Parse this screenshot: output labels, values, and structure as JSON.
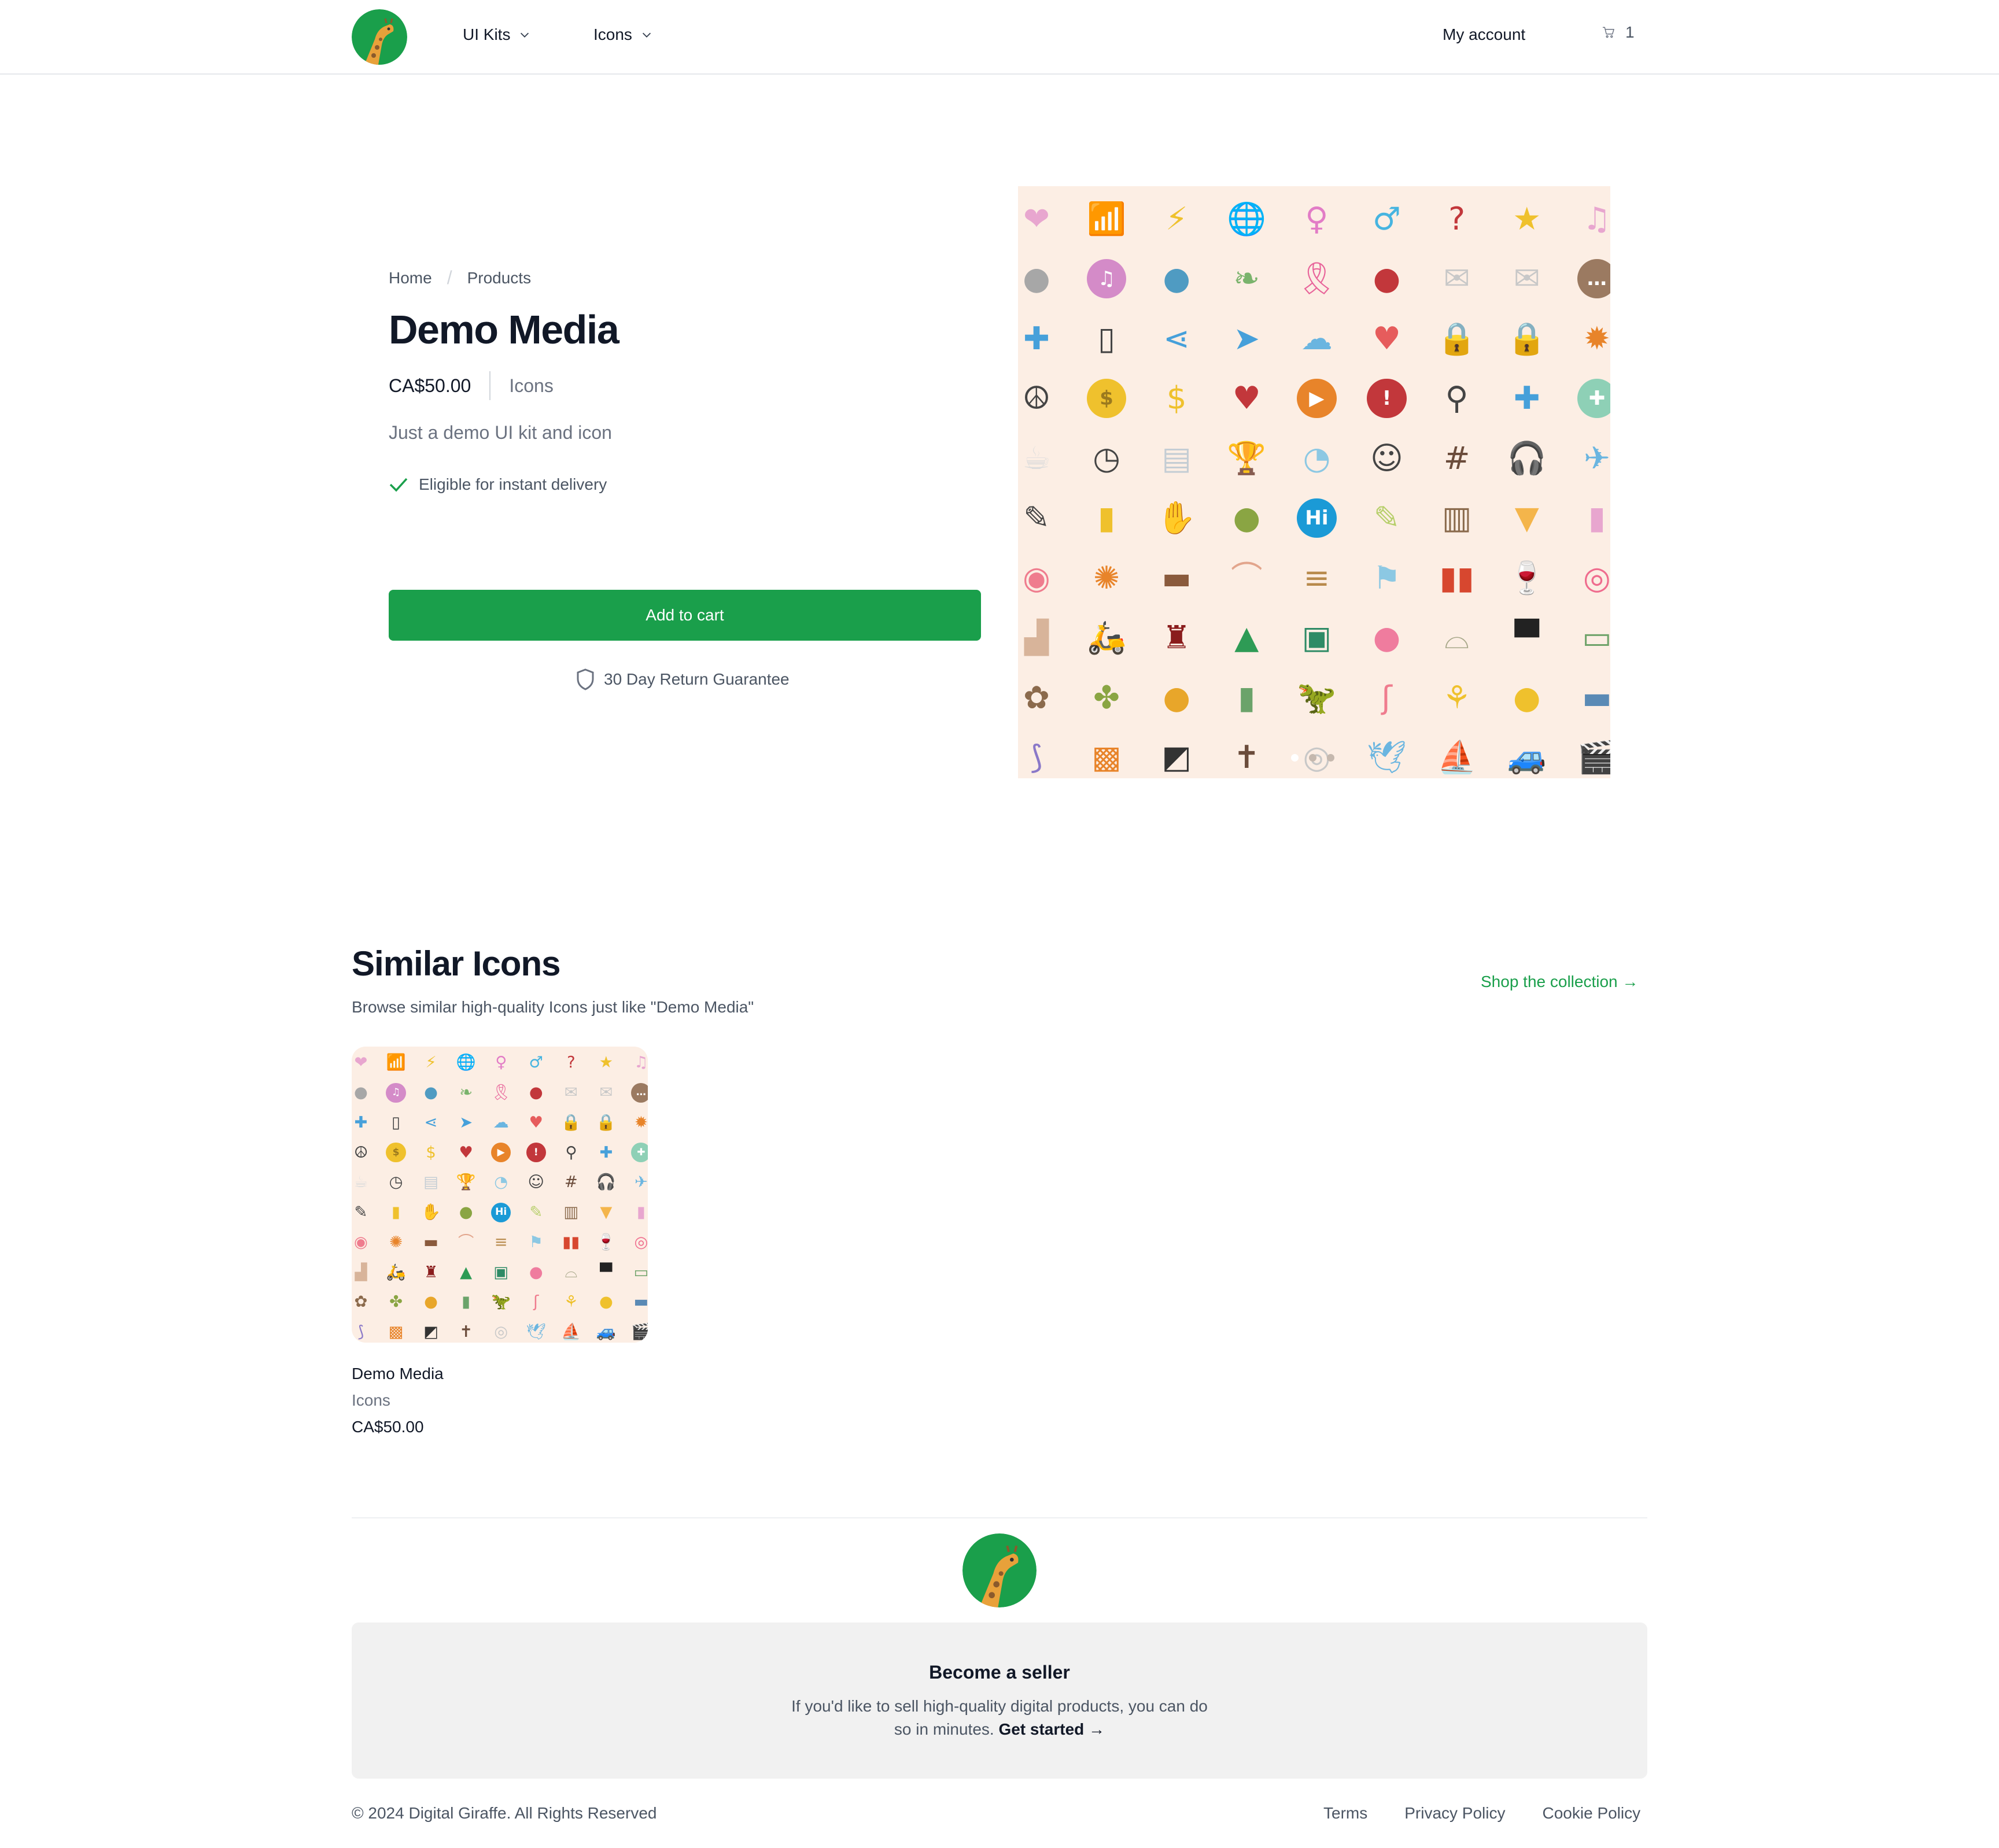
{
  "header": {
    "logo_alt": "Digital Giraffe",
    "nav": [
      {
        "label": "UI Kits"
      },
      {
        "label": "Icons"
      }
    ],
    "account_label": "My account",
    "cart_count": "1"
  },
  "product": {
    "breadcrumb": [
      {
        "label": "Home"
      },
      {
        "label": "Products"
      }
    ],
    "breadcrumb_separator": "/",
    "title": "Demo Media",
    "price": "CA$50.00",
    "category": "Icons",
    "description": "Just a demo UI kit and icon",
    "eligibility": "Eligible for instant delivery",
    "add_to_cart": "Add to cart",
    "guarantee": "30 Day Return Guarantee",
    "carousel": {
      "slides": 3,
      "active": 1
    }
  },
  "icon_grid": [
    [
      {
        "g": "❤",
        "c": "#e8a6cf"
      },
      {
        "g": "📶",
        "c": "#1b9ad6",
        "t": "wifi"
      },
      {
        "g": "⚡",
        "c": "#efc12d"
      },
      {
        "g": "🌐",
        "c": "#8cc8e3",
        "t": "globe"
      },
      {
        "g": "♀",
        "c": "#e27cc6"
      },
      {
        "g": "♂",
        "c": "#46b4e0"
      },
      {
        "g": "?",
        "c": "#c2373b"
      },
      {
        "g": "★",
        "c": "#efc12d"
      },
      {
        "g": "♫",
        "c": "#e8a6cf"
      }
    ],
    [
      {
        "g": "●",
        "c": "#a7a7a7",
        "t": "speech"
      },
      {
        "g": "♫",
        "c": "#fff",
        "bg": "#d48bc8",
        "t": "bubble"
      },
      {
        "g": "●",
        "c": "#4f9bc2",
        "t": "earth"
      },
      {
        "g": "❧",
        "c": "#7ab36c"
      },
      {
        "g": "🎗",
        "c": "#e8649a",
        "t": "ribbon"
      },
      {
        "g": "●",
        "c": "#c2373b",
        "t": "pin"
      },
      {
        "g": "✉",
        "c": "#c8c8c8"
      },
      {
        "g": "✉",
        "c": "#c8c8c8"
      },
      {
        "g": "…",
        "c": "#fff",
        "bg": "#9b7a61",
        "t": "bubble"
      }
    ],
    [
      {
        "g": "✚",
        "c": "#46a0da",
        "t": "puzzle"
      },
      {
        "g": "▯",
        "c": "#444"
      },
      {
        "g": "⋖",
        "c": "#46a0da",
        "t": "share"
      },
      {
        "g": "➤",
        "c": "#46a0da",
        "t": "plane"
      },
      {
        "g": "☁",
        "c": "#6ab5e0"
      },
      {
        "g": "♥",
        "c": "#e65c5c",
        "t": "rainbowheart"
      },
      {
        "g": "🔒",
        "c": "#efc12d",
        "t": "lock"
      },
      {
        "g": "🔒",
        "c": "#efc12d",
        "t": "lock"
      },
      {
        "g": "✹",
        "c": "#e8842a"
      }
    ],
    [
      {
        "g": "☮",
        "c": "#444"
      },
      {
        "g": "$",
        "c": "#9b7a1e",
        "bg": "#efc12d",
        "t": "coin"
      },
      {
        "g": "$",
        "c": "#efc12d"
      },
      {
        "g": "♥",
        "c": "#c2373b"
      },
      {
        "g": "▶",
        "c": "#fff",
        "bg": "#e8842a",
        "t": "video"
      },
      {
        "g": "!",
        "c": "#fff",
        "bg": "#c2373b",
        "t": "bubble"
      },
      {
        "g": "⚲",
        "c": "#444"
      },
      {
        "g": "✚",
        "c": "#46a0da"
      },
      {
        "g": "✚",
        "c": "#fff",
        "bg": "#8ed0b6",
        "t": "bubble"
      }
    ],
    [
      {
        "g": "☕",
        "c": "#dcdcdc"
      },
      {
        "g": "◷",
        "c": "#444"
      },
      {
        "g": "▤",
        "c": "#c4cdd4"
      },
      {
        "g": "🏆",
        "c": "#efc12d",
        "t": "trophy"
      },
      {
        "g": "◔",
        "c": "#8cc8e3"
      },
      {
        "g": "☺",
        "c": "#444"
      },
      {
        "g": "#",
        "c": "#6b4c3b"
      },
      {
        "g": "🎧",
        "c": "#1d5d78",
        "t": "headphones"
      },
      {
        "g": "✈",
        "c": "#6ab5e0"
      }
    ],
    [
      {
        "g": "✎",
        "c": "#444"
      },
      {
        "g": "▮",
        "c": "#efc12d"
      },
      {
        "g": "✋",
        "c": "#dcdcdc"
      },
      {
        "g": "●",
        "c": "#8aa543",
        "t": "avocado"
      },
      {
        "g": "Hi",
        "c": "#fff",
        "bg": "#1b9ad6",
        "t": "bubble"
      },
      {
        "g": "✎",
        "c": "#b7cf6b"
      },
      {
        "g": "▥",
        "c": "#8a6a4c"
      },
      {
        "g": "▼",
        "c": "#f4b54b"
      },
      {
        "g": "▮",
        "c": "#e8a6cf"
      }
    ],
    [
      {
        "g": "◉",
        "c": "#ef7c8e"
      },
      {
        "g": "✺",
        "c": "#e8842a"
      },
      {
        "g": "▬",
        "c": "#8a5a3c"
      },
      {
        "g": "⌒",
        "c": "#e2a58c"
      },
      {
        "g": "≡",
        "c": "#b88a4c"
      },
      {
        "g": "⚑",
        "c": "#8cc8e3"
      },
      {
        "g": "▮▮",
        "c": "#d7472f"
      },
      {
        "g": "🍷",
        "c": "#8a1c2a",
        "t": "wine"
      },
      {
        "g": "◎",
        "c": "#ef6c8e"
      }
    ],
    [
      {
        "g": "▟",
        "c": "#d8b49a"
      },
      {
        "g": "🛵",
        "c": "#8cc8e3",
        "t": "scooter"
      },
      {
        "g": "♜",
        "c": "#8a1c1c"
      },
      {
        "g": "▲",
        "c": "#2e9b55"
      },
      {
        "g": "▣",
        "c": "#2e8b66"
      },
      {
        "g": "●",
        "c": "#ef7c9e",
        "t": "egg"
      },
      {
        "g": "⌓",
        "c": "#a8a88a"
      },
      {
        "g": "▀",
        "c": "#222"
      },
      {
        "g": "▭",
        "c": "#6fa36a"
      }
    ],
    [
      {
        "g": "✿",
        "c": "#8b6a4c"
      },
      {
        "g": "✤",
        "c": "#8aa543"
      },
      {
        "g": "●",
        "c": "#e8a62a",
        "t": "plant"
      },
      {
        "g": "▮",
        "c": "#6ba36a"
      },
      {
        "g": "🦖",
        "c": "#4a5a3a",
        "t": "dino"
      },
      {
        "g": "ʃ",
        "c": "#ef7c8e"
      },
      {
        "g": "⚘",
        "c": "#efc12d"
      },
      {
        "g": "●",
        "c": "#efc12d",
        "t": "pineapple"
      },
      {
        "g": "▬",
        "c": "#5a8ab5"
      }
    ],
    [
      {
        "g": "⟆",
        "c": "#8a78c8"
      },
      {
        "g": "▩",
        "c": "#e8842a"
      },
      {
        "g": "◩",
        "c": "#333"
      },
      {
        "g": "✝",
        "c": "#6b4c3b"
      },
      {
        "g": "◎",
        "c": "#c8c8c8"
      },
      {
        "g": "🕊",
        "c": "#6ab5e0",
        "t": "dove"
      },
      {
        "g": "⛵",
        "c": "#e8a62a",
        "t": "sailboat"
      },
      {
        "g": "🚙",
        "c": "#6fa36a",
        "t": "car"
      },
      {
        "g": "🎬",
        "c": "#333",
        "t": "clapper"
      }
    ]
  ],
  "similar": {
    "title": "Similar Icons",
    "subtitle": "Browse similar high-quality Icons just like \"Demo Media\"",
    "shop_link": "Shop the collection →",
    "cards": [
      {
        "name": "Demo Media",
        "category": "Icons",
        "price": "CA$50.00"
      }
    ]
  },
  "footer": {
    "seller_title": "Become a seller",
    "seller_text_1": "If you'd like to sell high-quality digital products, you can do",
    "seller_text_2": "so in minutes.",
    "seller_link": "Get started →",
    "copyright": "© 2024 Digital Giraffe. All Rights Reserved",
    "links": [
      {
        "label": "Terms"
      },
      {
        "label": "Privacy Policy"
      },
      {
        "label": "Cookie Policy"
      }
    ]
  },
  "colors": {
    "brand_green": "#1a9f4b",
    "grid_bg": "#fceee4",
    "text_dark": "#111827",
    "text_muted": "#6b7280"
  }
}
